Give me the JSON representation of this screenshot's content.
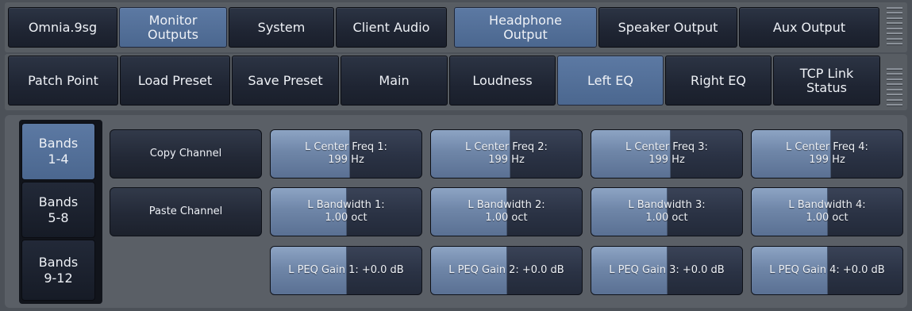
{
  "top_tabs": [
    {
      "label": "Omnia.9sg",
      "active": false
    },
    {
      "label": "Monitor\nOutputs",
      "active": true
    },
    {
      "label": "System",
      "active": false
    },
    {
      "label": "Client Audio",
      "active": false
    },
    {
      "label": "Headphone\nOutput",
      "active": true
    },
    {
      "label": "Speaker Output",
      "active": false
    },
    {
      "label": "Aux Output",
      "active": false
    }
  ],
  "sub_tabs": [
    {
      "label": "Patch Point",
      "active": false
    },
    {
      "label": "Load Preset",
      "active": false
    },
    {
      "label": "Save Preset",
      "active": false
    },
    {
      "label": "Main",
      "active": false
    },
    {
      "label": "Loudness",
      "active": false
    },
    {
      "label": "Left EQ",
      "active": true
    },
    {
      "label": "Right EQ",
      "active": false
    },
    {
      "label": "TCP Link\nStatus",
      "active": false
    }
  ],
  "band_tabs": [
    {
      "line1": "Bands",
      "line2": "1-4",
      "active": true
    },
    {
      "line1": "Bands",
      "line2": "5-8",
      "active": false
    },
    {
      "line1": "Bands",
      "line2": "9-12",
      "active": false
    }
  ],
  "actions": {
    "copy": "Copy Channel",
    "paste": "Paste Channel"
  },
  "center_freq": [
    {
      "line1": "L Center Freq 1:",
      "line2": "199 Hz",
      "level": 0.52
    },
    {
      "line1": "L Center Freq 2:",
      "line2": "199 Hz",
      "level": 0.52
    },
    {
      "line1": "L Center Freq 3:",
      "line2": "199 Hz",
      "level": 0.52
    },
    {
      "line1": "L Center Freq 4:",
      "line2": "199 Hz",
      "level": 0.52
    }
  ],
  "bandwidth": [
    {
      "line1": "L Bandwidth 1:",
      "line2": "1.00 oct",
      "level": 0.5
    },
    {
      "line1": "L Bandwidth 2:",
      "line2": "1.00 oct",
      "level": 0.5
    },
    {
      "line1": "L Bandwidth 3:",
      "line2": "1.00 oct",
      "level": 0.5
    },
    {
      "line1": "L Bandwidth 4:",
      "line2": "1.00 oct",
      "level": 0.5
    }
  ],
  "peq_gain": [
    {
      "line1": "L PEQ Gain 1: +0.0 dB",
      "level": 0.5
    },
    {
      "line1": "L PEQ Gain 2: +0.0 dB",
      "level": 0.5
    },
    {
      "line1": "L PEQ Gain 3: +0.0 dB",
      "level": 0.5
    },
    {
      "line1": "L PEQ Gain 4: +0.0 dB",
      "level": 0.5
    }
  ]
}
